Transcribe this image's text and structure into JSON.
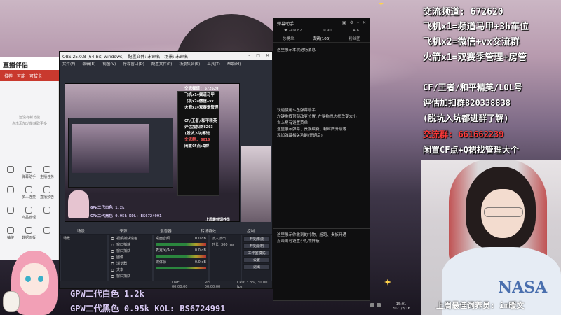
{
  "assistant": {
    "logo": "直播伴侣",
    "tabs": [
      "推荐",
      "可能",
      "可拔卡"
    ],
    "empty_text": [
      "还没有新功能",
      "点击添加功能获取更多"
    ],
    "grid": [
      {
        "label": "",
        "icon": "user-icon"
      },
      {
        "label": "弹幕助手",
        "icon": "chat-icon"
      },
      {
        "label": "主播任务",
        "icon": "task-icon"
      },
      {
        "label": "",
        "icon": "gift-icon"
      },
      {
        "label": "多人连麦",
        "icon": "mic-icon"
      },
      {
        "label": "直播预告",
        "icon": "calendar-icon"
      },
      {
        "label": "",
        "icon": "star-icon"
      },
      {
        "label": "商品管理",
        "icon": "box-icon"
      },
      {
        "label": "",
        "icon": "chart-icon"
      },
      {
        "label": "抽奖",
        "icon": "lottery-icon"
      },
      {
        "label": "数据面板",
        "icon": "data-icon"
      },
      {
        "label": "",
        "icon": "more-icon"
      }
    ]
  },
  "obs": {
    "title": "OBS 25.0.8 (64-bit, windows) - 配置文件: 未命名 - 场景: 未命名",
    "menu": [
      "文件(F)",
      "编辑(E)",
      "视图(V)",
      "停靠窗口(D)",
      "配置文件(P)",
      "场景集合(S)",
      "工具(T)",
      "帮助(H)"
    ],
    "preview_texts": {
      "channel": "交流频道: 672620",
      "plane1": "飞机x1=频道马甲",
      "plane2": "飞机x2=微信+vx",
      "rocket": "火箭x1=双赛季管理",
      "cf": "CF/王者/和平精英",
      "eval": "评估加扣群8203",
      "leave": "(脱坑入坑都进",
      "group": "交流群: 6616",
      "idle": "闲置CF点+Q群",
      "bottom1": "GPW二代白色 1.2k",
      "bottom2": "GPW二代黑色 0.95k    KOL: BS6724991",
      "cam_caption": "上周最佳饲养员"
    },
    "dock_heads": [
      "场景",
      "来源",
      "混音器",
      "转场特效",
      "控制"
    ],
    "scenes": [
      "场景"
    ],
    "sources": [
      "视频捕获设备",
      "窗口捕获",
      "窗口捕获",
      "图像",
      "浏览器",
      "文本",
      "窗口捕获"
    ],
    "mixer": [
      {
        "label": "桌面音频",
        "db": "0.0 dB"
      },
      {
        "label": "麦克风/Aux",
        "db": "0.0 dB"
      },
      {
        "label": "媒体源",
        "db": "0.0 dB"
      }
    ],
    "transition": {
      "type": "淡入淡出",
      "duration_label": "时长",
      "duration": "300 ms"
    },
    "controls": [
      "开始推流",
      "开始录制",
      "工作室模式",
      "设置",
      "退出"
    ],
    "status": {
      "live": "LIVE: 00:00:00",
      "rec": "REC: 00:00:00",
      "cpu": "CPU: 3.3%, 30.00 fps"
    }
  },
  "danmaku": {
    "title": "弹幕助手",
    "stats": [
      {
        "icon": "heart-icon",
        "value": "249082"
      },
      {
        "icon": "chat-icon",
        "value": "90"
      },
      {
        "icon": "gift-icon",
        "value": "6"
      }
    ],
    "tabs": [
      "总榜单",
      "贵宾(106)",
      "粉丝团"
    ],
    "top_text": "这里展示本次进场消息",
    "help_lines": [
      "欢迎使用斗鱼弹幕助手",
      "左键拖拽顶部改变位置, 左键拖拽边框改变大小",
      "右上角有设置菜单",
      "这里展示弹幕、贵族续费、粉丝牌升级等",
      "添加弹幕相关功能(开通后)"
    ],
    "bottom_lines": [
      "这里展示你收到的礼物、超跑、贵族开通",
      "点击即可设置小礼物屏蔽"
    ]
  },
  "overlay_right": {
    "channel": "交流频道: 672620",
    "plane1": "飞机x1=频道马甲+3h车位",
    "plane2": "飞机x2=微信+vx交流群",
    "rocket": "火箭x1=双赛季管理+房管",
    "games": "CF/王者/和平精英/LOL号",
    "eval": "评估加扣群820338838",
    "leave": "(脱坑入坑都进群了解)",
    "group": "交流群: 661662239",
    "idle": "闲置CF点+Q裙找管理大个"
  },
  "overlay_bottom": {
    "line1": "GPW二代白色 1.2k",
    "line2": "GPW二代黑色 0.95k    KOL: BS6724991",
    "cam_caption": "上周最佳饲养员: im暖文",
    "shirt_text": "NASA"
  },
  "taskbar": {
    "time": "15:01",
    "date": "2021/8/16"
  },
  "colors": {
    "accent_red": "#ff3a3a",
    "brand_red": "#c9392e",
    "text_lavender": "#d7c8f2"
  }
}
